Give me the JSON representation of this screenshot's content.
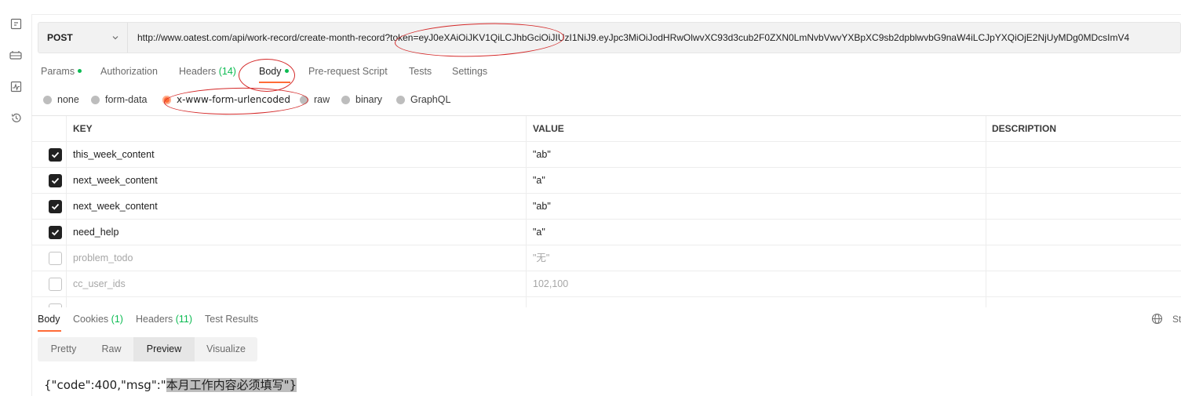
{
  "request": {
    "method": "POST",
    "url": "http://www.oatest.com/api/work-record/create-month-record?token=eyJ0eXAiOiJKV1QiLCJhbGciOiJIUzI1NiJ9.eyJpc3MiOiJodHRwOlwvXC93d3cub2F0ZXN0LmNvbVwvYXBpXC9sb2dpblwvbG9naW4iLCJpYXQiOjE2NjUyMDg0MDcsImV4"
  },
  "request_tabs": [
    {
      "label": "Params"
    },
    {
      "label": "Authorization"
    },
    {
      "label": "Headers",
      "count": "(14)"
    },
    {
      "label": "Body"
    },
    {
      "label": "Pre-request Script"
    },
    {
      "label": "Tests"
    },
    {
      "label": "Settings"
    }
  ],
  "body_types": [
    "none",
    "form-data",
    "x-www-form-urlencoded",
    "raw",
    "binary",
    "GraphQL"
  ],
  "selected_body_type": "x-www-form-urlencoded",
  "table": {
    "headers": {
      "key": "KEY",
      "value": "VALUE",
      "description": "DESCRIPTION"
    },
    "rows": [
      {
        "checked": true,
        "key": "this_week_content",
        "value": "\"ab\"",
        "description": ""
      },
      {
        "checked": true,
        "key": "next_week_content",
        "value": "\"a\"",
        "description": ""
      },
      {
        "checked": true,
        "key": "next_week_content",
        "value": "\"ab\"",
        "description": ""
      },
      {
        "checked": true,
        "key": "need_help",
        "value": "\"a\"",
        "description": ""
      },
      {
        "checked": false,
        "key": "problem_todo",
        "value": "\"无\"",
        "description": ""
      },
      {
        "checked": false,
        "key": "cc_user_ids",
        "value": "102,100",
        "description": ""
      }
    ]
  },
  "response_tabs": [
    {
      "label": "Body"
    },
    {
      "label": "Cookies",
      "count": "(1)"
    },
    {
      "label": "Headers",
      "count": "(11)"
    },
    {
      "label": "Test Results"
    }
  ],
  "response_status_partial": "St",
  "response_formats": [
    "Pretty",
    "Raw",
    "Preview",
    "Visualize"
  ],
  "active_format": "Preview",
  "response_body": {
    "prefix": "{\"code\":400,\"msg\":\"",
    "highlighted": "本月工作内容必须填写\"}"
  },
  "colors": {
    "accent": "#ff6c37",
    "success": "#0cbb52",
    "annotation": "#d42a2a"
  },
  "sidebar_icons": [
    "apis-icon",
    "environments-icon",
    "monitors-icon",
    "history-icon"
  ]
}
